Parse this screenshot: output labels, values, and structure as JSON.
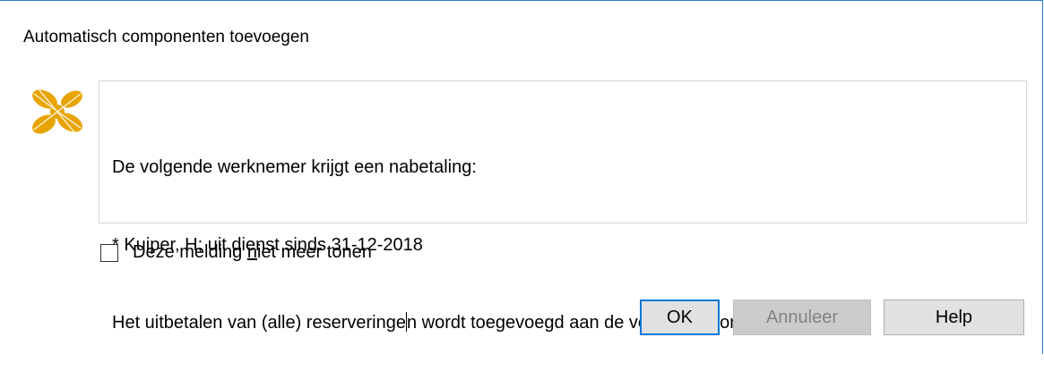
{
  "dialog": {
    "title": "Automatisch componenten toevoegen",
    "logo_icon": "flower-logo-icon",
    "accent_color": "#e8a400"
  },
  "message": {
    "line1": "De volgende werknemer krijgt een nabetaling:",
    "line2": "* Kuiper, H; uit dienst sinds 31-12-2018",
    "line3_before_caret": "Het uitbetalen van (alle) reserveringe",
    "line3_after_caret": "n wordt toegevoegd aan de verloningscomponenten."
  },
  "checkbox": {
    "label_before": "Deze melding ",
    "label_underlined": "n",
    "label_after": "iet meer tonen",
    "checked": false
  },
  "buttons": {
    "ok_label": "OK",
    "cancel_label": "Annuleer",
    "cancel_disabled": true,
    "help_label": "Help"
  }
}
